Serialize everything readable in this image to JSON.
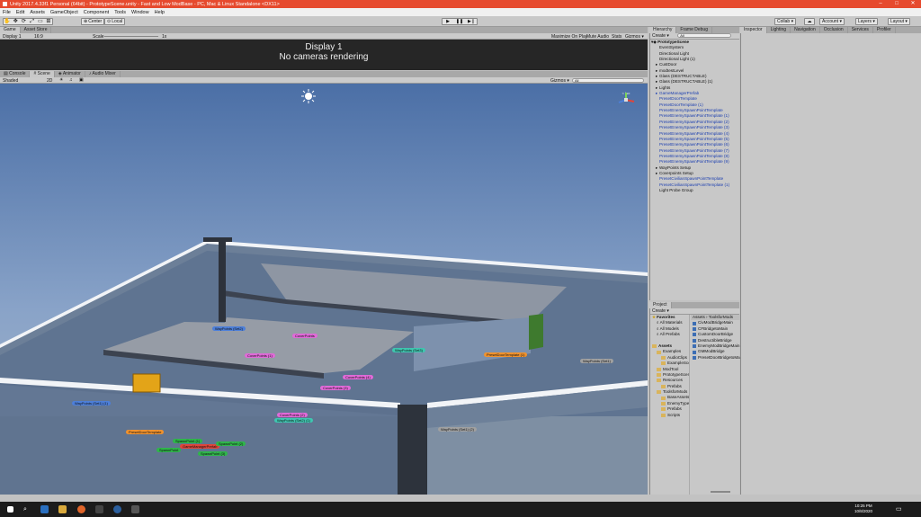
{
  "window": {
    "title": "Unity 2017.4.33f1 Personal (64bit) - PrototypeScene.unity - Fast and Low ModBase - PC, Mac & Linux Standalone <DX11>",
    "controls": [
      "–",
      "□",
      "✕"
    ]
  },
  "menu": [
    "File",
    "Edit",
    "Assets",
    "GameObject",
    "Component",
    "Tools",
    "Window",
    "Help"
  ],
  "toolbar": {
    "pivot": "Center",
    "space": "Local",
    "collab": "Collab ▾",
    "account": "Account ▾",
    "layers": "Layers ▾",
    "layout": "Layout ▾"
  },
  "game_tabs": [
    "Game",
    "Asset Store"
  ],
  "game_bar": {
    "display": "Display 1",
    "aspect": "16:9",
    "scale_label": "Scale",
    "scale_value": "1x",
    "maximize": "Maximize On Play",
    "mute": "Mute Audio",
    "stats": "Stats",
    "gizmos": "Gizmos ▾"
  },
  "game_view": {
    "display": "Display 1",
    "message": "No cameras rendering"
  },
  "scene_tabs": [
    "Console",
    "Scene",
    "Animator",
    "Audio Mixer"
  ],
  "scene_bar": {
    "shading": "Shaded",
    "mode": "2D",
    "gizmos": "Gizmos ▾",
    "search": "All"
  },
  "gizmo": {
    "label": "< Iso"
  },
  "scene_labels": [
    {
      "text": "WayPoints (Set2)",
      "color": "#4d7fd9"
    },
    {
      "text": "CoverPoints",
      "color": "#e06ad8"
    },
    {
      "text": "CoverPoints (1)",
      "color": "#e06ad8"
    },
    {
      "text": "WayPoints (Set3)",
      "color": "#3fc6b0"
    },
    {
      "text": "PresetDoorTemplate (1)",
      "color": "#f0922e"
    },
    {
      "text": "WayPoints (Set1)",
      "color": "#a0a0a0"
    },
    {
      "text": "CoverPoints (4)",
      "color": "#e06ad8"
    },
    {
      "text": "CoverPoints (3)",
      "color": "#e06ad8"
    },
    {
      "text": "WayPoints (Set1) (1)",
      "color": "#4d7fd9"
    },
    {
      "text": "CoverPoints (2)",
      "color": "#e06ad8"
    },
    {
      "text": "WayPoints (Set2) (1)",
      "color": "#3fc6b0"
    },
    {
      "text": "WayPoints (Set1) (2)",
      "color": "#a0a0a0"
    },
    {
      "text": "PresetDoorTemplate",
      "color": "#f0922e"
    },
    {
      "text": "SpawnPoint (1)",
      "color": "#2fb54a"
    },
    {
      "text": "GameManagerPrefab",
      "color": "#e0453a"
    },
    {
      "text": "SpawnPoint",
      "color": "#2fb54a"
    },
    {
      "text": "SpawnPoint (2)",
      "color": "#2fb54a"
    },
    {
      "text": "SpawnPoint (3)",
      "color": "#2fb54a"
    }
  ],
  "hierarchy": {
    "tabs": [
      "Hierarchy",
      "Frame Debug"
    ],
    "create": "Create ▾",
    "search": "All",
    "scene": "PrototypeScene",
    "items": [
      {
        "text": "EventSystem",
        "prefab": false,
        "fold": false
      },
      {
        "text": "Directional Light",
        "prefab": false,
        "fold": false
      },
      {
        "text": "Directional Light (1)",
        "prefab": false,
        "fold": false
      },
      {
        "text": "CustDoor",
        "prefab": false,
        "fold": true
      },
      {
        "text": "modtestLevel",
        "prefab": false,
        "fold": true
      },
      {
        "text": "Glass (DESTRUCTABLE)",
        "prefab": false,
        "fold": true
      },
      {
        "text": "Glass (DESTRUCTABLE) (1)",
        "prefab": false,
        "fold": true
      },
      {
        "text": "Lights",
        "prefab": false,
        "fold": true
      },
      {
        "text": "GameManagerPrefab",
        "prefab": true,
        "fold": true
      },
      {
        "text": "PresetDoorTemplate",
        "prefab": true,
        "fold": false
      },
      {
        "text": "PresetDoorTemplate (1)",
        "prefab": true,
        "fold": false
      },
      {
        "text": "PresetEnemySpawnPointTemplate",
        "prefab": true,
        "fold": false
      },
      {
        "text": "PresetEnemySpawnPointTemplate (1)",
        "prefab": true,
        "fold": false
      },
      {
        "text": "PresetEnemySpawnPointTemplate (2)",
        "prefab": true,
        "fold": false
      },
      {
        "text": "PresetEnemySpawnPointTemplate (3)",
        "prefab": true,
        "fold": false
      },
      {
        "text": "PresetEnemySpawnPointTemplate (4)",
        "prefab": true,
        "fold": false
      },
      {
        "text": "PresetEnemySpawnPointTemplate (5)",
        "prefab": true,
        "fold": false
      },
      {
        "text": "PresetEnemySpawnPointTemplate (6)",
        "prefab": true,
        "fold": false
      },
      {
        "text": "PresetEnemySpawnPointTemplate (7)",
        "prefab": true,
        "fold": false
      },
      {
        "text": "PresetEnemySpawnPointTemplate (8)",
        "prefab": true,
        "fold": false
      },
      {
        "text": "PresetEnemySpawnPointTemplate (9)",
        "prefab": true,
        "fold": false
      },
      {
        "text": "WayPoints Setup",
        "prefab": false,
        "fold": true
      },
      {
        "text": "Coverpoints Setup",
        "prefab": false,
        "fold": true
      },
      {
        "text": "PresetCivilianSpawnPointTemplate",
        "prefab": true,
        "fold": false
      },
      {
        "text": "PresetCivilianSpawnPointTemplate (1)",
        "prefab": true,
        "fold": false
      },
      {
        "text": "Light Probe Group",
        "prefab": false,
        "fold": false
      }
    ]
  },
  "inspector": {
    "tabs": [
      "Inspector",
      "Lighting",
      "Navigation",
      "Occlusion",
      "Services",
      "Profiler"
    ]
  },
  "project": {
    "tab": "Project",
    "create": "Create ▾",
    "breadcrumb": "Assets › ToolsforMods",
    "tree": [
      {
        "text": "Favorites",
        "bold": true,
        "indent": 0,
        "icon": "star"
      },
      {
        "text": "All Materials",
        "bold": false,
        "indent": 1,
        "icon": "search"
      },
      {
        "text": "All Models",
        "bold": false,
        "indent": 1,
        "icon": "search"
      },
      {
        "text": "All Prefabs",
        "bold": false,
        "indent": 1,
        "icon": "search"
      },
      {
        "text": "",
        "bold": false,
        "indent": 0,
        "icon": "none"
      },
      {
        "text": "Assets",
        "bold": true,
        "indent": 0,
        "icon": "folder"
      },
      {
        "text": "Examples",
        "bold": false,
        "indent": 1,
        "icon": "folder"
      },
      {
        "text": "AudioClips",
        "bold": false,
        "indent": 2,
        "icon": "folder"
      },
      {
        "text": "ExampleScenes",
        "bold": false,
        "indent": 2,
        "icon": "folder"
      },
      {
        "text": "ModTool",
        "bold": false,
        "indent": 1,
        "icon": "folder"
      },
      {
        "text": "PrototypeScenes",
        "bold": false,
        "indent": 1,
        "icon": "folder"
      },
      {
        "text": "Resources",
        "bold": false,
        "indent": 1,
        "icon": "folder"
      },
      {
        "text": "Prefabs",
        "bold": false,
        "indent": 2,
        "icon": "folder"
      },
      {
        "text": "ToolsforMods",
        "bold": false,
        "indent": 1,
        "icon": "folder"
      },
      {
        "text": "BaseAssets",
        "bold": false,
        "indent": 2,
        "icon": "folder"
      },
      {
        "text": "EnemyTypes",
        "bold": false,
        "indent": 2,
        "icon": "folder"
      },
      {
        "text": "Prefabs",
        "bold": false,
        "indent": 2,
        "icon": "folder"
      },
      {
        "text": "Scripts",
        "bold": false,
        "indent": 2,
        "icon": "folder"
      }
    ],
    "files": [
      "CivModBridgeMain",
      "CFBridgetoMain",
      "CustomDoorBridge",
      "DestructibleBridge",
      "EnemyModBridgeMain",
      "GMModBridge",
      "PresetDoorBridgetoMain"
    ]
  },
  "taskbar": {
    "time": "10:25 PM",
    "date": "10/8/2020"
  }
}
